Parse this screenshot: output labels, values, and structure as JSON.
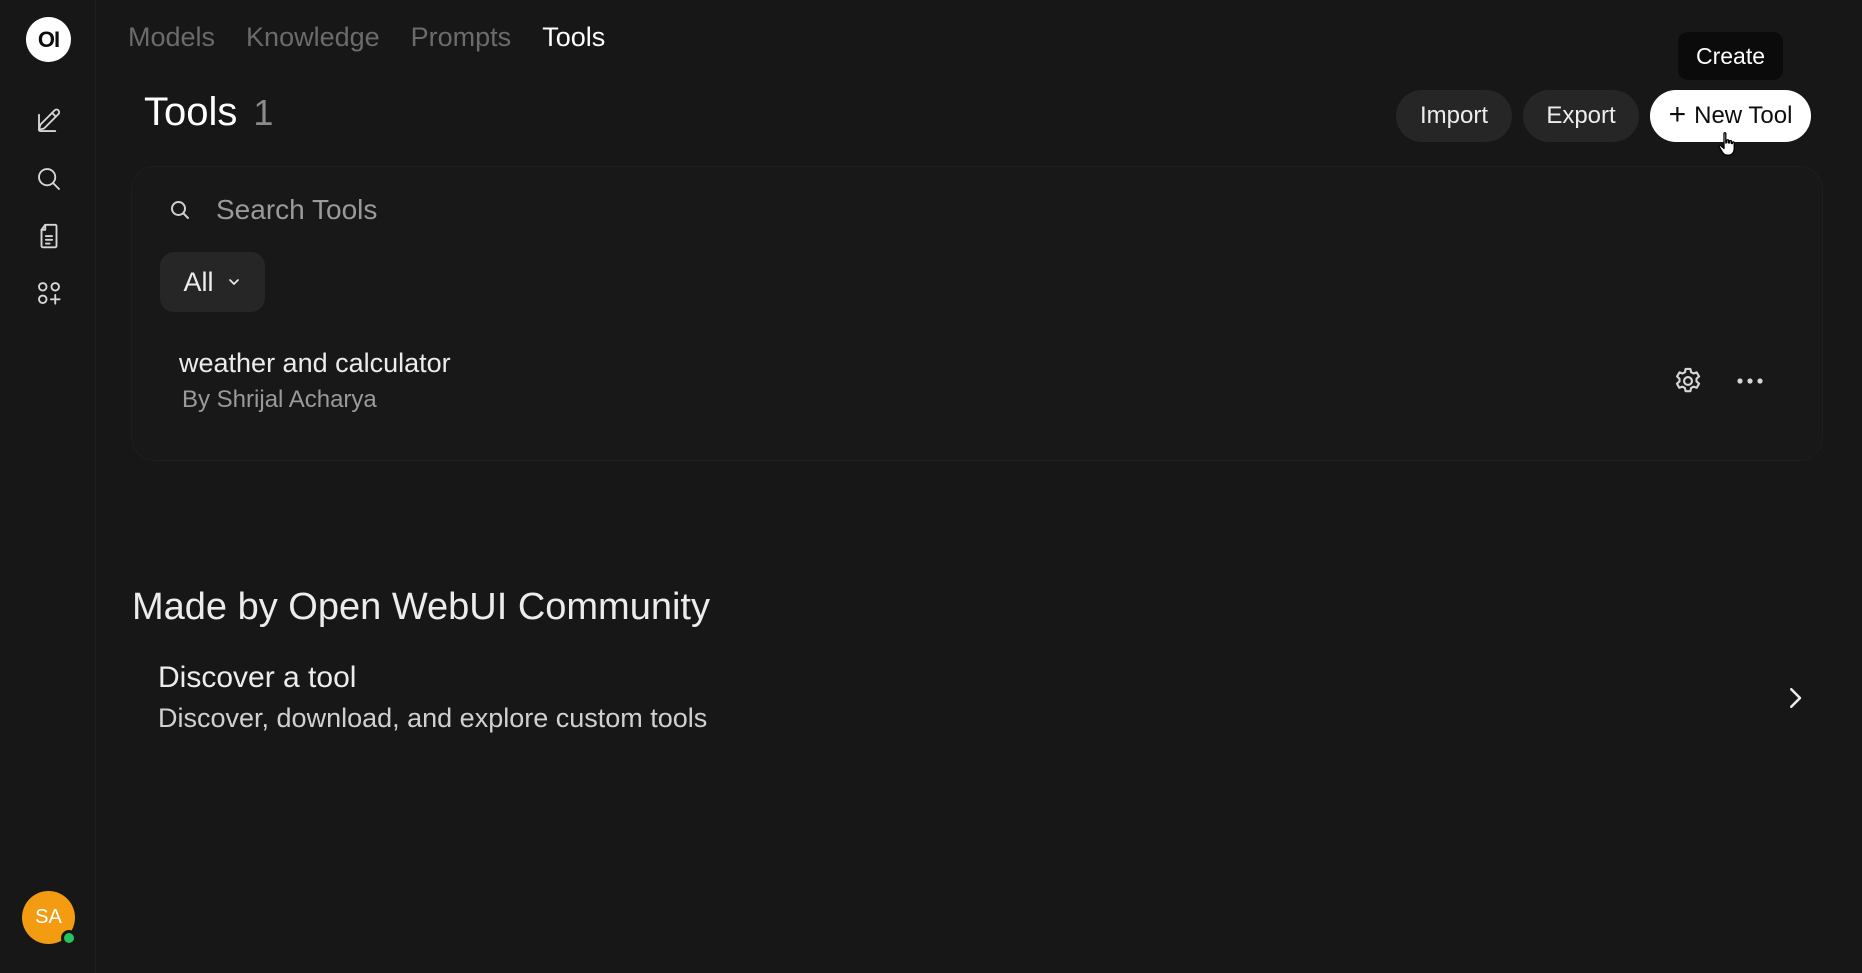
{
  "sidebar": {
    "logo_text": "OI",
    "icons": [
      "new-chat-icon",
      "search-icon",
      "notes-icon",
      "workspace-icon"
    ],
    "avatar_initials": "SA",
    "avatar_color": "#f39c12",
    "status_color": "#22c55e"
  },
  "nav": {
    "tabs": [
      {
        "label": "Models",
        "active": false
      },
      {
        "label": "Knowledge",
        "active": false
      },
      {
        "label": "Prompts",
        "active": false
      },
      {
        "label": "Tools",
        "active": true
      }
    ]
  },
  "header": {
    "title": "Tools",
    "count": "1",
    "import_label": "Import",
    "export_label": "Export",
    "new_label": "New Tool",
    "tooltip": "Create"
  },
  "search": {
    "placeholder": "Search Tools",
    "value": ""
  },
  "filter": {
    "selected": "All"
  },
  "tools": [
    {
      "name": "weather and calculator",
      "author": "By Shrijal Acharya"
    }
  ],
  "community": {
    "title": "Made by Open WebUI Community",
    "discover_title": "Discover a tool",
    "discover_desc": "Discover, download, and explore custom tools"
  },
  "colors": {
    "background": "#171717",
    "panel": "#181818",
    "button_dark": "#262626",
    "button_primary": "#ffffff"
  }
}
